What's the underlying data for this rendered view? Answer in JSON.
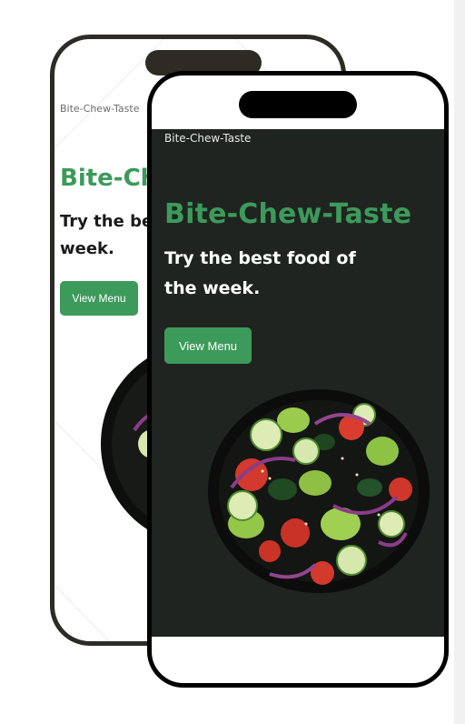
{
  "app": {
    "brand_name": "Bite-Chew-Taste",
    "hero_title": "Bite-Chew-Taste",
    "tagline": "Try the best food of the week.",
    "cta_label": "View Menu"
  },
  "back_phone": {
    "brand_small": "Bite-Chew-Taste",
    "title_visible": "Bite-Ch",
    "tagline_visible": "Try the bes the week.",
    "cta_label": "View Menu"
  },
  "colors": {
    "accent": "#3c9a5b",
    "dark_screen": "#1f2420",
    "frame_back": "#2e2b25",
    "frame_front": "#000000"
  },
  "images": {
    "hero_image": "salad-bowl"
  }
}
